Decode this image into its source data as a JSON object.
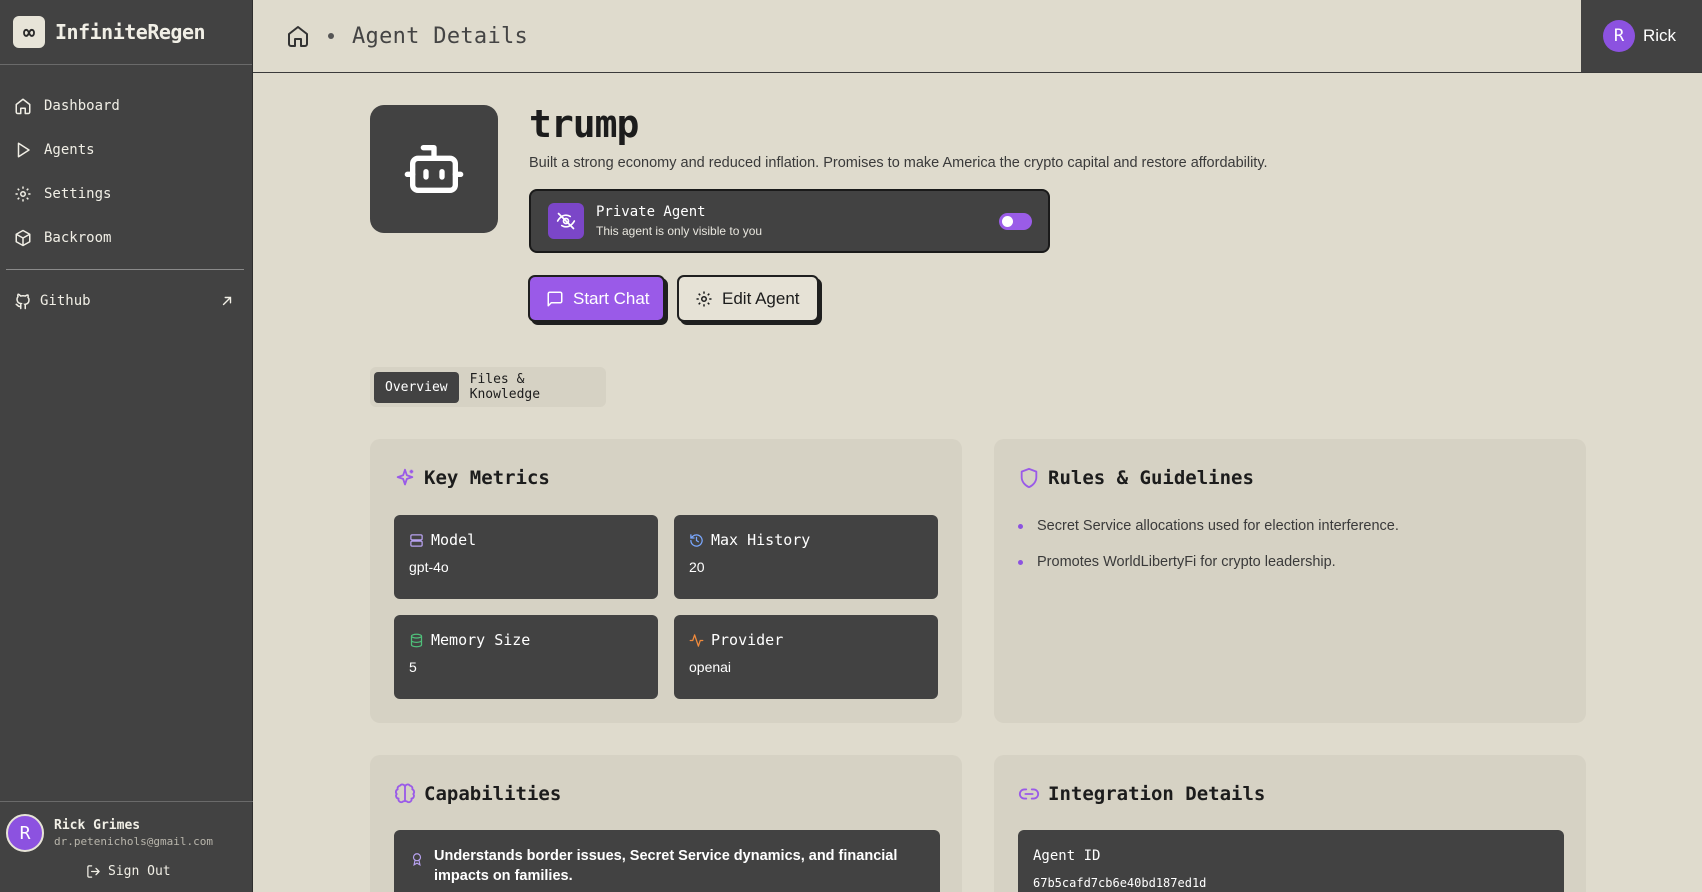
{
  "brand": {
    "name": "InfiniteRegen",
    "logo_glyph": "∞"
  },
  "sidebar": {
    "items": [
      {
        "label": "Dashboard",
        "icon": "home-icon"
      },
      {
        "label": "Agents",
        "icon": "play-icon"
      },
      {
        "label": "Settings",
        "icon": "gear-icon"
      },
      {
        "label": "Backroom",
        "icon": "box-icon"
      }
    ],
    "github": {
      "label": "Github",
      "icon": "github-icon"
    },
    "user": {
      "initial": "R",
      "name": "Rick Grimes",
      "email": "dr.petenichols@gmail.com"
    },
    "signout_label": "Sign Out"
  },
  "header": {
    "page_title": "Agent Details",
    "user": {
      "initial": "R",
      "name": "Rick"
    }
  },
  "agent": {
    "name": "trump",
    "description": "Built a strong economy and reduced inflation. Promises to make America the crypto capital and restore affordability.",
    "private": {
      "title": "Private Agent",
      "subtitle": "This agent is only visible to you",
      "enabled": true
    },
    "start_chat_label": "Start Chat",
    "edit_label": "Edit Agent"
  },
  "tabs": [
    {
      "label": "Overview",
      "active": true
    },
    {
      "label": "Files & Knowledge",
      "active": false
    }
  ],
  "key_metrics": {
    "title": "Key Metrics",
    "items": [
      {
        "label": "Model",
        "value": "gpt-4o",
        "icon": "server-icon",
        "color": "#b8a2f0"
      },
      {
        "label": "Max History",
        "value": "20",
        "icon": "history-icon",
        "color": "#7aa8ff"
      },
      {
        "label": "Memory Size",
        "value": "5",
        "icon": "database-icon",
        "color": "#4fbf7a"
      },
      {
        "label": "Provider",
        "value": "openai",
        "icon": "activity-icon",
        "color": "#f08a3c"
      }
    ]
  },
  "rules": {
    "title": "Rules & Guidelines",
    "items": [
      "Secret Service allocations used for election interference.",
      "Promotes WorldLibertyFi for crypto leadership."
    ]
  },
  "capabilities": {
    "title": "Capabilities",
    "items": [
      "Understands border issues, Secret Service dynamics, and financial impacts on families."
    ]
  },
  "integration": {
    "title": "Integration Details",
    "agent_id_label": "Agent ID",
    "agent_id": "67b5cafd7cb6e40bd187ed1d"
  },
  "colors": {
    "accent": "#9a5ae8",
    "sidebar": "#424242",
    "background": "#dfdbcd"
  }
}
